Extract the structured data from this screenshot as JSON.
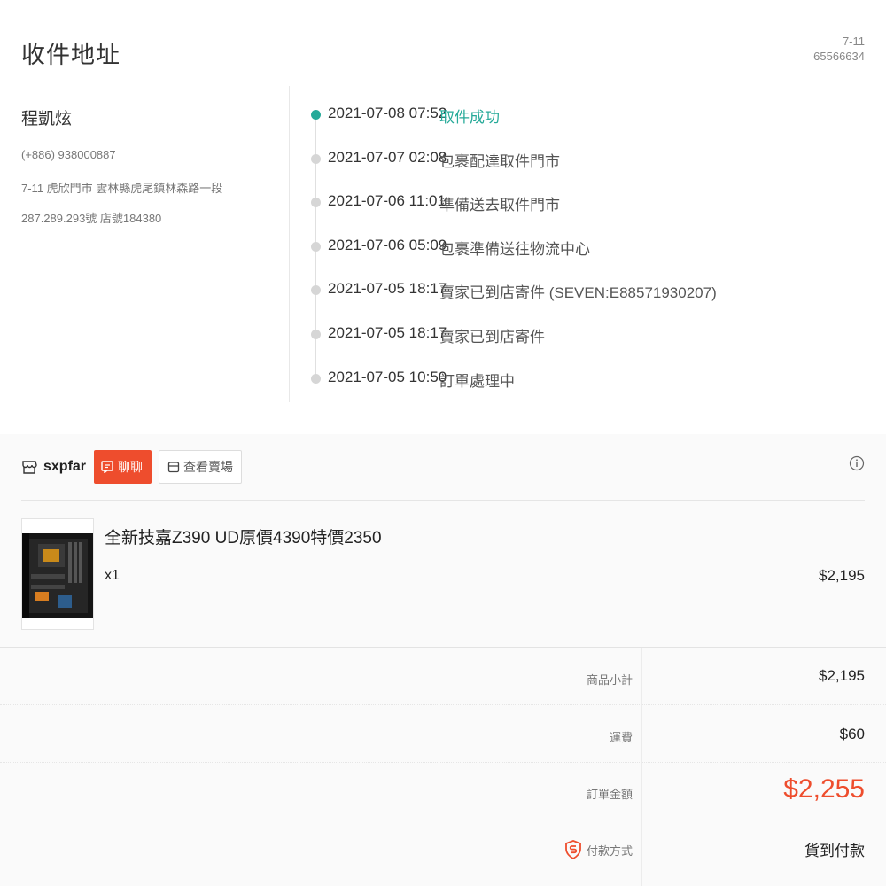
{
  "address": {
    "title": "收件地址",
    "carrier_line1": "7-11",
    "carrier_line2": "65566634",
    "name": "程凱炫",
    "phone": "(+886) 938000887",
    "address_line1": "7-11 虎欣門市 雲林縣虎尾鎮林森路一段",
    "address_line2": "287.289.293號 店號184380"
  },
  "timeline": [
    {
      "time": "2021-07-08 07:52",
      "desc": "取件成功",
      "active": true
    },
    {
      "time": "2021-07-07 02:08",
      "desc": "包裹配達取件門市",
      "active": false
    },
    {
      "time": "2021-07-06 11:01",
      "desc": "準備送去取件門市",
      "active": false
    },
    {
      "time": "2021-07-06 05:09",
      "desc": "包裹準備送往物流中心",
      "active": false
    },
    {
      "time": "2021-07-05 18:17",
      "desc": "賣家已到店寄件 (SEVEN:E88571930207)",
      "active": false
    },
    {
      "time": "2021-07-05 18:17",
      "desc": "賣家已到店寄件",
      "active": false
    },
    {
      "time": "2021-07-05 10:50",
      "desc": "訂單處理中",
      "active": false
    }
  ],
  "shop": {
    "name": "sxpfar",
    "chat_label": "聊聊",
    "view_shop_label": "查看賣場"
  },
  "product": {
    "name": "全新技嘉Z390 UD原價4390特價2350",
    "quantity": "x1",
    "price": "$2,195"
  },
  "summary": {
    "subtotal_label": "商品小計",
    "subtotal_value": "$2,195",
    "shipping_label": "運費",
    "shipping_value": "$60",
    "total_label": "訂單金額",
    "total_value": "$2,255",
    "payment_label": "付款方式",
    "payment_value": "貨到付款"
  },
  "colors": {
    "accent_green": "#26aa99",
    "brand_orange": "#ee4d2d"
  }
}
